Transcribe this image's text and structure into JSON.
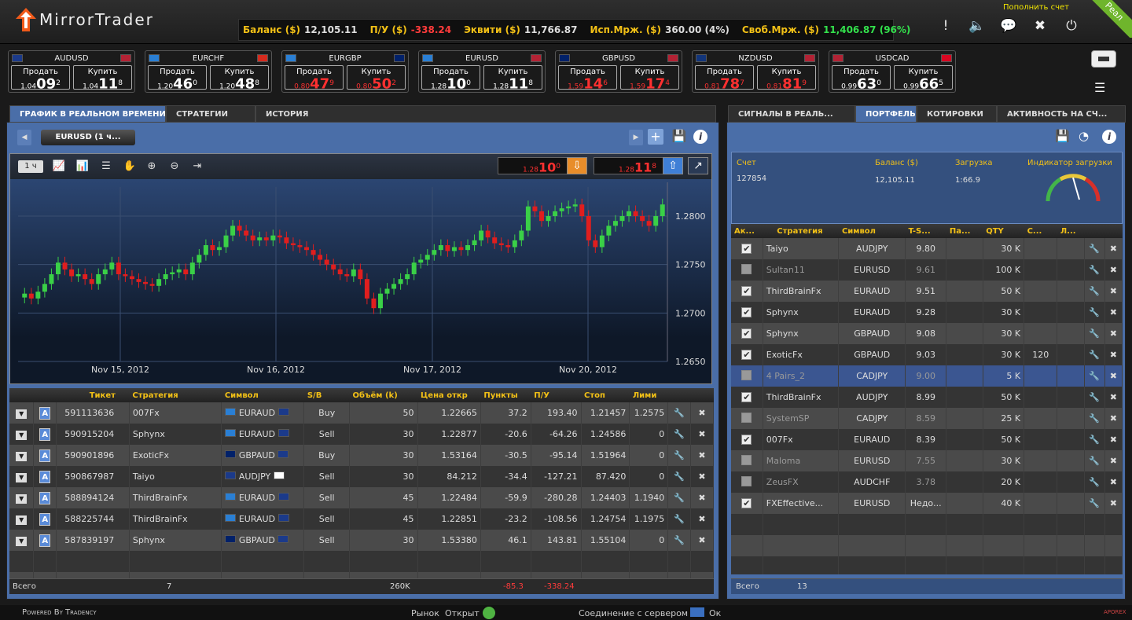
{
  "app": {
    "name": "MirrorTrader"
  },
  "account_bar": {
    "balance_label": "Баланс ($)",
    "balance": "12,105.11",
    "pl_label": "П/У ($)",
    "pl": "-338.24",
    "equity_label": "Эквити ($)",
    "equity": "11,766.87",
    "used_margin_label": "Исп.Мрж. ($)",
    "used_margin": "360.00 (4%)",
    "free_margin_label": "Своб.Мрж. ($)",
    "free_margin": "11,406.87 (96%)"
  },
  "deposit_link": "Пополнить счет",
  "corner_badge": "Реал",
  "tickers": [
    {
      "symbol": "AUDUSD",
      "sell_label": "Продать",
      "buy_label": "Купить",
      "sell_pre": "1.04",
      "sell_big": "09",
      "sell_sup": "2",
      "buy_pre": "1.04",
      "buy_big": "11",
      "buy_sup": "8"
    },
    {
      "symbol": "EURCHF",
      "sell_label": "Продать",
      "buy_label": "Купить",
      "sell_pre": "1.20",
      "sell_big": "46",
      "sell_sup": "0",
      "buy_pre": "1.20",
      "buy_big": "48",
      "buy_sup": "8"
    },
    {
      "symbol": "EURGBP",
      "sell_label": "Продать",
      "buy_label": "Купить",
      "sell_pre": "0.80",
      "sell_big": "47",
      "sell_sup": "9",
      "buy_pre": "0.80",
      "buy_big": "50",
      "buy_sup": "2"
    },
    {
      "symbol": "EURUSD",
      "sell_label": "Продать",
      "buy_label": "Купить",
      "sell_pre": "1.28",
      "sell_big": "10",
      "sell_sup": "0",
      "buy_pre": "1.28",
      "buy_big": "11",
      "buy_sup": "8"
    },
    {
      "symbol": "GBPUSD",
      "sell_label": "Продать",
      "buy_label": "Купить",
      "sell_pre": "1.59",
      "sell_big": "14",
      "sell_sup": "6",
      "buy_pre": "1.59",
      "buy_big": "17",
      "buy_sup": "4"
    },
    {
      "symbol": "NZDUSD",
      "sell_label": "Продать",
      "buy_label": "Купить",
      "sell_pre": "0.81",
      "sell_big": "78",
      "sell_sup": "7",
      "buy_pre": "0.81",
      "buy_big": "81",
      "buy_sup": "9"
    },
    {
      "symbol": "USDCAD",
      "sell_label": "Продать",
      "buy_label": "Купить",
      "sell_pre": "0.99",
      "sell_big": "63",
      "sell_sup": "0",
      "buy_pre": "0.99",
      "buy_big": "66",
      "buy_sup": "5"
    }
  ],
  "left_tabs": [
    "ГРАФИК В РЕАЛЬНОМ ВРЕМЕНИ",
    "СТРАТЕГИИ",
    "ИСТОРИЯ"
  ],
  "right_tabs": [
    "СИГНАЛЫ В РЕАЛЬ...",
    "ПОРТФЕЛЬ",
    "КОТИРОВКИ",
    "АКТИВНОСТЬ НА СЧ..."
  ],
  "chart_symbol": "EURUSD (1 ч...",
  "timeframe": "1 ч",
  "chart_quote_sell": {
    "pre": "1.28",
    "big": "10",
    "sup": "0"
  },
  "chart_quote_buy": {
    "pre": "1.28",
    "big": "11",
    "sup": "8"
  },
  "chart_data": {
    "type": "candlestick",
    "x_labels": [
      "Nov 15, 2012",
      "Nov 16, 2012",
      "Nov 17, 2012",
      "Nov 20, 2012"
    ],
    "y_ticks": [
      "1.2800",
      "1.2750",
      "1.2700",
      "1.2650"
    ],
    "ylim": [
      1.265,
      1.283
    ],
    "closes": [
      1.272,
      1.2715,
      1.2722,
      1.273,
      1.274,
      1.2752,
      1.2745,
      1.2738,
      1.274,
      1.2735,
      1.273,
      1.274,
      1.2745,
      1.2752,
      1.274,
      1.2738,
      1.2735,
      1.2732,
      1.273,
      1.2728,
      1.2735,
      1.274,
      1.2742,
      1.2745,
      1.274,
      1.2752,
      1.276,
      1.277,
      1.2765,
      1.2768,
      1.278,
      1.279,
      1.2785,
      1.278,
      1.2775,
      1.2778,
      1.2775,
      1.278,
      1.2778,
      1.2772,
      1.277,
      1.2768,
      1.2765,
      1.276,
      1.2755,
      1.275,
      1.2745,
      1.274,
      1.2738,
      1.2745,
      1.2735,
      1.2715,
      1.2705,
      1.272,
      1.2725,
      1.273,
      1.2735,
      1.274,
      1.2752,
      1.2755,
      1.276,
      1.2765,
      1.277,
      1.2764,
      1.2768,
      1.2765,
      1.277,
      1.2775,
      1.2785,
      1.2778,
      1.2772,
      1.277,
      1.2768,
      1.2775,
      1.2785,
      1.281,
      1.2805,
      1.2795,
      1.28,
      1.2805,
      1.2808,
      1.281,
      1.2812,
      1.28,
      1.2775,
      1.2768,
      1.278,
      1.279,
      1.2795,
      1.28,
      1.2805,
      1.28,
      1.2795,
      1.279,
      1.28,
      1.2812
    ]
  },
  "positions": {
    "headers": [
      "Тикет",
      "Стратегия",
      "Символ",
      "S/B",
      "Объём (k)",
      "Цена откр",
      "Пункты",
      "П/У",
      "Стоп",
      "Лими"
    ],
    "rows": [
      {
        "ticket": "591113636",
        "strategy": "007Fx",
        "symbol": "EURAUD",
        "side": "Buy",
        "volume": "50",
        "open": "1.22665",
        "pips": "37.2",
        "pl": "193.40",
        "stop": "1.21457",
        "limit": "1.2575",
        "pos": true
      },
      {
        "ticket": "590915204",
        "strategy": "Sphynx",
        "symbol": "EURAUD",
        "side": "Sell",
        "volume": "30",
        "open": "1.22877",
        "pips": "-20.6",
        "pl": "-64.26",
        "stop": "1.24586",
        "limit": "0",
        "pos": false
      },
      {
        "ticket": "590901896",
        "strategy": "ExoticFx",
        "symbol": "GBPAUD",
        "side": "Buy",
        "volume": "30",
        "open": "1.53164",
        "pips": "-30.5",
        "pl": "-95.14",
        "stop": "1.51964",
        "limit": "0",
        "pos": false
      },
      {
        "ticket": "590867987",
        "strategy": "Taiyo",
        "symbol": "AUDJPY",
        "side": "Sell",
        "volume": "30",
        "open": "84.212",
        "pips": "-34.4",
        "pl": "-127.21",
        "stop": "87.420",
        "limit": "0",
        "pos": false
      },
      {
        "ticket": "588894124",
        "strategy": "ThirdBrainFx",
        "symbol": "EURAUD",
        "side": "Sell",
        "volume": "45",
        "open": "1.22484",
        "pips": "-59.9",
        "pl": "-280.28",
        "stop": "1.24403",
        "limit": "1.1940",
        "pos": false
      },
      {
        "ticket": "588225744",
        "strategy": "ThirdBrainFx",
        "symbol": "EURAUD",
        "side": "Sell",
        "volume": "45",
        "open": "1.22851",
        "pips": "-23.2",
        "pl": "-108.56",
        "stop": "1.24754",
        "limit": "1.1975",
        "pos": false
      },
      {
        "ticket": "587839197",
        "strategy": "Sphynx",
        "symbol": "GBPAUD",
        "side": "Sell",
        "volume": "30",
        "open": "1.53380",
        "pips": "46.1",
        "pl": "143.81",
        "stop": "1.55104",
        "limit": "0",
        "pos": true
      }
    ],
    "totals": {
      "label": "Всего",
      "count": "7",
      "volume": "260K",
      "pips": "-85.3",
      "pl": "-338.24"
    }
  },
  "portfolio_summary": {
    "account_label": "Счет",
    "account": "127854",
    "balance_label": "Баланс ($)",
    "balance": "12,105.11",
    "load_label": "Загрузка",
    "load": "1:66.9",
    "gauge_label": "Индикатор загрузки"
  },
  "portfolio": {
    "headers": [
      "Ак...",
      "Стратегия",
      "Символ",
      "T-S...",
      "Па...",
      "QTY",
      "С...",
      "Л..."
    ],
    "rows": [
      {
        "active": true,
        "strategy": "Taiyo",
        "symbol": "AUDJPY",
        "score": "9.80",
        "qty": "30 K",
        "c": ""
      },
      {
        "active": false,
        "strategy": "Sultan11",
        "symbol": "EURUSD",
        "score": "9.61",
        "qty": "100 K",
        "c": ""
      },
      {
        "active": true,
        "strategy": "ThirdBrainFx",
        "symbol": "EURAUD",
        "score": "9.51",
        "qty": "50 K",
        "c": ""
      },
      {
        "active": true,
        "strategy": "Sphynx",
        "symbol": "EURAUD",
        "score": "9.28",
        "qty": "30 K",
        "c": ""
      },
      {
        "active": true,
        "strategy": "Sphynx",
        "symbol": "GBPAUD",
        "score": "9.08",
        "qty": "30 K",
        "c": ""
      },
      {
        "active": true,
        "strategy": "ExoticFx",
        "symbol": "GBPAUD",
        "score": "9.03",
        "qty": "30 K",
        "c": "120"
      },
      {
        "active": false,
        "strategy": "4 Pairs_2",
        "symbol": "CADJPY",
        "score": "9.00",
        "qty": "5 K",
        "c": ""
      },
      {
        "active": true,
        "strategy": "ThirdBrainFx",
        "symbol": "AUDJPY",
        "score": "8.99",
        "qty": "50 K",
        "c": ""
      },
      {
        "active": false,
        "strategy": "SystemSP",
        "symbol": "CADJPY",
        "score": "8.59",
        "qty": "25 K",
        "c": ""
      },
      {
        "active": true,
        "strategy": "007Fx",
        "symbol": "EURAUD",
        "score": "8.39",
        "qty": "50 K",
        "c": ""
      },
      {
        "active": false,
        "strategy": "Maloma",
        "symbol": "EURUSD",
        "score": "7.55",
        "qty": "30 K",
        "c": ""
      },
      {
        "active": false,
        "strategy": "ZeusFX",
        "symbol": "AUDCHF",
        "score": "3.78",
        "qty": "20 K",
        "c": ""
      },
      {
        "active": true,
        "strategy": "FXEffective...",
        "symbol": "EURUSD",
        "score": "Недо...",
        "qty": "40 K",
        "c": ""
      }
    ],
    "totals": {
      "label": "Всего",
      "count": "13"
    }
  },
  "footer": {
    "powered": "Powered By Tradency",
    "market_label": "Рынок",
    "market_status": "Открыт",
    "server_label": "Соединение с сервером",
    "server_status": "Ок",
    "brand": "APOREX"
  }
}
